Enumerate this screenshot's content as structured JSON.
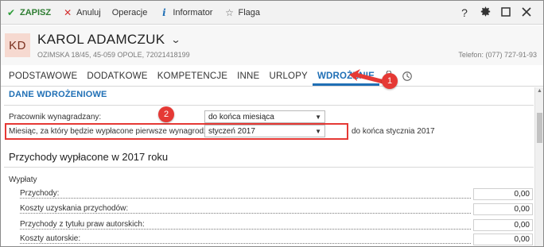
{
  "toolbar": {
    "save": "ZAPISZ",
    "cancel": "Anuluj",
    "operations": "Operacje",
    "informer": "Informator",
    "flag": "Flaga",
    "help": "?"
  },
  "header": {
    "initials": "KD",
    "name": "KAROL ADAMCZUK",
    "address": "OZIMSKA 18/45, 45-059 OPOLE, 72021418199",
    "phone": "Telefon: (077) 727-91-93"
  },
  "tabs": [
    {
      "label": "PODSTAWOWE"
    },
    {
      "label": "DODATKOWE"
    },
    {
      "label": "KOMPETENCJE"
    },
    {
      "label": "INNE"
    },
    {
      "label": "URLOPY"
    },
    {
      "label": "WDROŻENIE"
    }
  ],
  "section": {
    "title": "DANE WDROŻENIOWE",
    "employee_paid_label": "Pracownik wynagradzany:",
    "employee_paid_value": "do końca miesiąca",
    "first_pay_month_label": "Miesiąc, za który będzie wypłacone pierwsze wynagrodzenie:",
    "first_pay_month_value": "styczeń 2017",
    "first_pay_note": "do końca stycznia 2017"
  },
  "income": {
    "heading": "Przychody wypłacone w 2017 roku",
    "group_label": "Wypłaty",
    "rows": [
      {
        "label": "Przychody:",
        "value": "0,00"
      },
      {
        "label": "Koszty uzyskania przychodów:",
        "value": "0,00"
      },
      {
        "label": "Przychody z tytułu praw autorskich:",
        "value": "0,00"
      },
      {
        "label": "Koszty autorskie:",
        "value": "0,00"
      }
    ]
  },
  "callouts": {
    "one": "1",
    "two": "2"
  },
  "colors": {
    "accent": "#1f6fb5",
    "save": "#2e7d32",
    "callout": "#e53935"
  },
  "icons": [
    "check-icon",
    "close-icon",
    "info-icon",
    "star-icon",
    "help-icon",
    "gear-icon",
    "maximize-icon",
    "close-window-icon",
    "chevron-down-icon",
    "paperclip-icon",
    "history-icon"
  ]
}
